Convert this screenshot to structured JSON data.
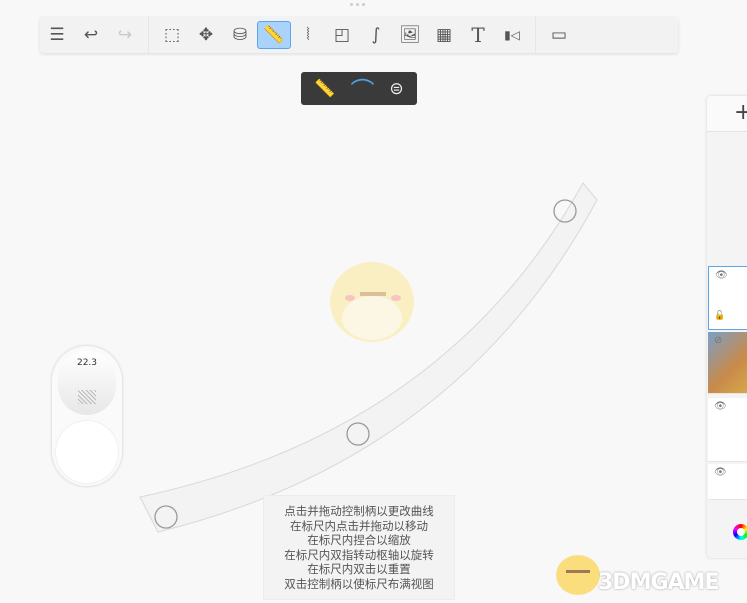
{
  "toolbar": {
    "items": [
      {
        "name": "list-icon",
        "glyph": "☰"
      },
      {
        "name": "undo-icon",
        "glyph": "↩"
      },
      {
        "name": "redo-icon",
        "glyph": "↪"
      },
      {
        "name": "selection-icon",
        "glyph": "⬚"
      },
      {
        "name": "move-icon",
        "glyph": "✥"
      },
      {
        "name": "fill-icon",
        "glyph": "⛁"
      },
      {
        "name": "ruler-icon",
        "glyph": "📏"
      },
      {
        "name": "symmetry-icon",
        "glyph": "⦚"
      },
      {
        "name": "shapes-icon",
        "glyph": "◰"
      },
      {
        "name": "curve-icon",
        "glyph": "∫"
      },
      {
        "name": "image-icon",
        "glyph": "🖼"
      },
      {
        "name": "perspective-icon",
        "glyph": "▦"
      },
      {
        "name": "text-icon",
        "glyph": "T"
      },
      {
        "name": "video-icon",
        "glyph": "▮◁"
      },
      {
        "name": "frame-icon",
        "glyph": "▭"
      }
    ]
  },
  "subbar": {
    "straight": "📏",
    "curve": "⌒",
    "ellipse": "⊜"
  },
  "brush_size": "22.3",
  "hint_lines": [
    "点击并拖动控制柄以更改曲线",
    "在标尺内点击并拖动以移动",
    "在标尺内捏合以缩放",
    "在标尺内双指转动枢轴以旋转",
    "在标尺内双击以重置",
    "双击控制柄以使标尺布满视图"
  ],
  "layers": {
    "add": "+",
    "eye": "👁",
    "eye_hidden": "⊘",
    "lock": "🔓"
  },
  "watermark": "3DMGAME",
  "colors": {
    "accent": "#4ea0e6",
    "active_bg": "#a9d3fb"
  }
}
